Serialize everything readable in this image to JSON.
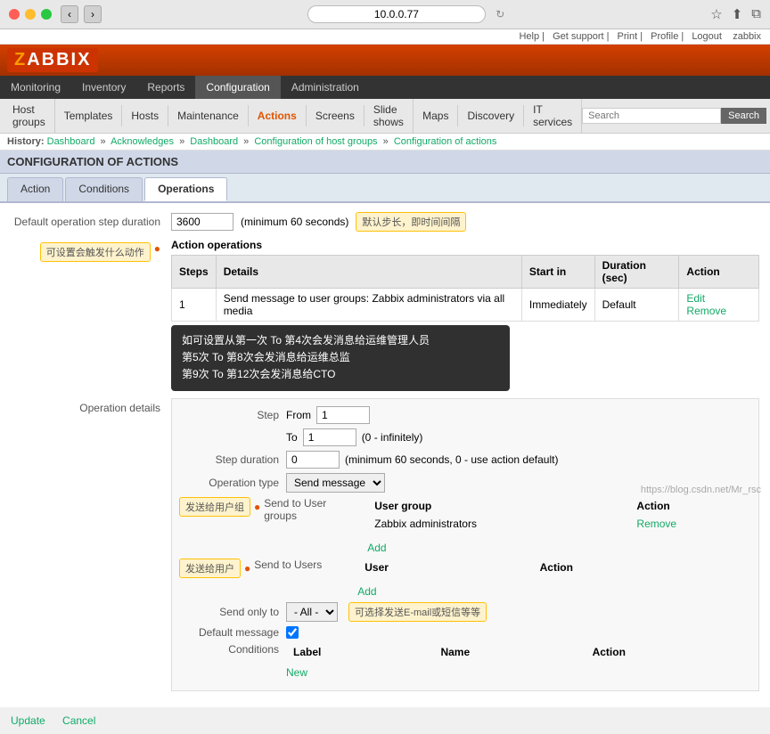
{
  "browser": {
    "address": "10.0.0.77",
    "traffic_lights": [
      "red",
      "yellow",
      "green"
    ]
  },
  "help_bar": {
    "links": [
      "Help",
      "Get support",
      "Print",
      "Profile",
      "Logout"
    ],
    "user": "zabbix"
  },
  "logo": "ZABBIX",
  "main_nav": {
    "items": [
      {
        "label": "Monitoring",
        "active": false
      },
      {
        "label": "Inventory",
        "active": false
      },
      {
        "label": "Reports",
        "active": false
      },
      {
        "label": "Configuration",
        "active": true
      },
      {
        "label": "Administration",
        "active": false
      }
    ]
  },
  "sub_nav": {
    "items": [
      {
        "label": "Host groups",
        "active": false
      },
      {
        "label": "Templates",
        "active": false
      },
      {
        "label": "Hosts",
        "active": false
      },
      {
        "label": "Maintenance",
        "active": false
      },
      {
        "label": "Actions",
        "active": true
      },
      {
        "label": "Screens",
        "active": false
      },
      {
        "label": "Slide shows",
        "active": false
      },
      {
        "label": "Maps",
        "active": false
      },
      {
        "label": "Discovery",
        "active": false
      },
      {
        "label": "IT services",
        "active": false
      }
    ],
    "search_placeholder": "Search"
  },
  "breadcrumb": {
    "items": [
      "Dashboard",
      "Acknowledges",
      "Dashboard",
      "Configuration of host groups",
      "Configuration of actions"
    ]
  },
  "section_title": "CONFIGURATION OF ACTIONS",
  "tabs": [
    "Action",
    "Conditions",
    "Operations"
  ],
  "active_tab": "Operations",
  "form": {
    "default_step_label": "Default operation step duration",
    "default_step_value": "3600",
    "default_step_hint": "(minimum 60 seconds)",
    "default_step_annotation": "默认步长，即时间间隔",
    "action_operations_label": "Action operations",
    "ops_table": {
      "headers": [
        "Steps",
        "Details",
        "Start in",
        "Duration (sec)",
        "Action"
      ],
      "rows": [
        {
          "steps": "1",
          "details": "Send message to user groups: Zabbix administrators via all media",
          "start_in": "Immediately",
          "duration": "Default",
          "actions": [
            "Edit",
            "Remove"
          ]
        }
      ]
    },
    "annotation_action_ops": "可设置会触发什么动作",
    "operation_details_label": "Operation details",
    "step": {
      "from_label": "From",
      "from_value": "1",
      "to_label": "To",
      "to_value": "1",
      "to_hint": "(0 - infinitely)",
      "duration_label": "Step duration",
      "duration_value": "0",
      "duration_hint": "(minimum 60 seconds, 0 - use action default)"
    },
    "operation_type_label": "Operation type",
    "operation_type_value": "Send message",
    "send_to_user_groups_label": "Send to User groups",
    "user_groups_table": {
      "headers": [
        "User group",
        "Action"
      ],
      "rows": [
        {
          "group": "Zabbix administrators",
          "action": "Remove"
        }
      ],
      "add_link": "Add"
    },
    "annotation_user_groups": "发送给用户组",
    "send_to_users_label": "Send to Users",
    "users_table": {
      "headers": [
        "User",
        "Action"
      ],
      "rows": [],
      "add_link": "Add"
    },
    "annotation_users": "发送给用户",
    "send_only_to_label": "Send only to",
    "send_only_to_value": "- All -",
    "annotation_send_only": "可选择发送E-mail或短信等等",
    "default_message_label": "Default message",
    "default_message_checked": true,
    "conditions_label": "Conditions",
    "conditions_table": {
      "headers": [
        "Label",
        "Name",
        "Action"
      ],
      "rows": [],
      "new_link": "New"
    },
    "tooltip": {
      "text": "如可设置从第一次 To 第4次会发消息给运维管理人员\n第5次 To 第8次会发消息给运维总监\n第9次 To 第12次会发消息给CTO"
    }
  },
  "bottom": {
    "update_label": "Update",
    "cancel_label": "Cancel"
  },
  "watermark": "https://blog.csdn.net/Mr_rsc"
}
